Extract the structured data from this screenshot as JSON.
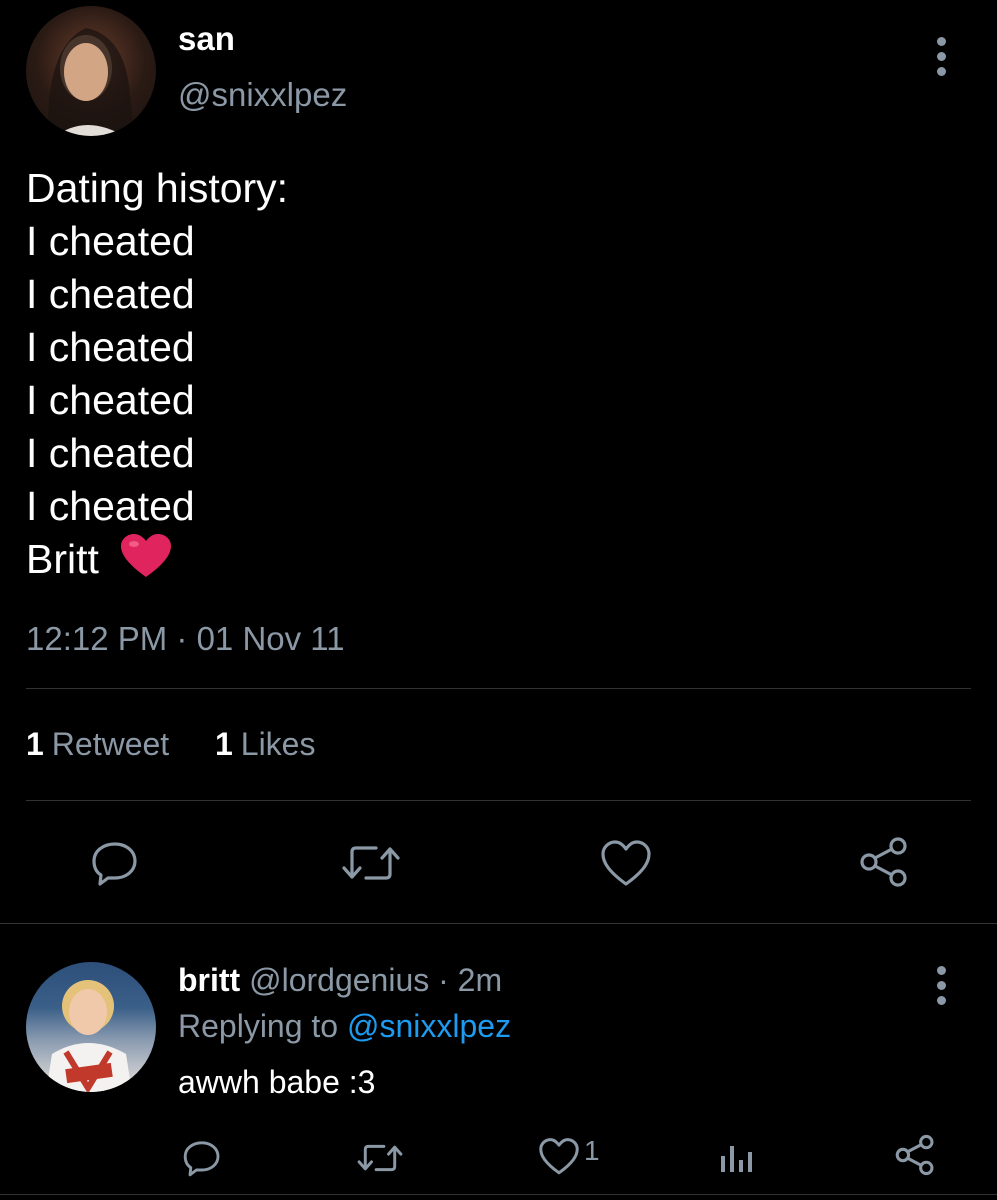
{
  "tweet": {
    "display_name": "san",
    "handle": "@snixxlpez",
    "avatar_icon": "profile-photo",
    "body_lines": [
      "Dating history:",
      "I cheated",
      "I cheated",
      "I cheated",
      "I cheated",
      "I cheated",
      "I cheated",
      "Britt"
    ],
    "emoji": "❤️",
    "timestamp": "12:12 PM · 01 Nov 11",
    "stats": {
      "retweet_count": "1",
      "retweet_label": "Retweet",
      "like_count": "1",
      "like_label": "Likes"
    },
    "actions": [
      "reply-icon",
      "retweet-icon",
      "like-icon",
      "share-icon"
    ]
  },
  "reply": {
    "display_name": "britt",
    "handle": "@lordgenius",
    "age": "· 2m",
    "replying_label": "Replying to",
    "replying_mention": "@snixxlpez",
    "text": "awwh babe :3",
    "like_count": "1",
    "actions": [
      "reply-icon",
      "retweet-icon",
      "like-icon",
      "analytics-icon",
      "share-icon"
    ]
  },
  "colors": {
    "background": "#000000",
    "text": "#ffffff",
    "secondary": "#8b98a5",
    "link": "#1d9bf0",
    "divider": "#2f3336",
    "heart_emoji": "#e0245e"
  }
}
